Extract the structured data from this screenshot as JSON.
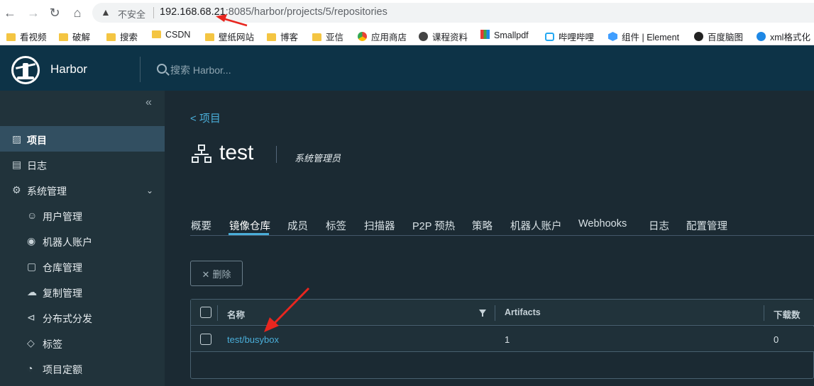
{
  "browser": {
    "insecure_label": "不安全",
    "url_host": "192.168.68.21",
    "url_rest": ":8085/harbor/projects/5/repositories"
  },
  "bookmarks": [
    {
      "label": "看视频",
      "icon": "folder-icon"
    },
    {
      "label": "破解",
      "icon": "folder-icon"
    },
    {
      "label": "搜索",
      "icon": "folder-icon"
    },
    {
      "label": "CSDN",
      "icon": "folder-icon"
    },
    {
      "label": "壁纸网站",
      "icon": "folder-icon"
    },
    {
      "label": "博客",
      "icon": "folder-icon"
    },
    {
      "label": "亚信",
      "icon": "folder-icon"
    },
    {
      "label": "应用商店",
      "icon": "app-store-icon"
    },
    {
      "label": "课程资料",
      "icon": "globe-icon"
    },
    {
      "label": "Smallpdf",
      "icon": "smallpdf-icon"
    },
    {
      "label": "哔哩哔哩",
      "icon": "bilibili-icon"
    },
    {
      "label": "组件 | Element",
      "icon": "element-icon"
    },
    {
      "label": "百度脑图",
      "icon": "owl-icon"
    },
    {
      "label": "xml格式化",
      "icon": "code-icon"
    }
  ],
  "header": {
    "brand": "Harbor",
    "search_placeholder": "搜索 Harbor..."
  },
  "sidebar": {
    "items": [
      {
        "label": "项目",
        "icon": "projects-icon"
      },
      {
        "label": "日志",
        "icon": "logs-icon"
      },
      {
        "label": "系统管理",
        "icon": "admin-icon"
      },
      {
        "label": "用户管理",
        "icon": "users-icon"
      },
      {
        "label": "机器人账户",
        "icon": "robot-icon"
      },
      {
        "label": "仓库管理",
        "icon": "registry-icon"
      },
      {
        "label": "复制管理",
        "icon": "replication-icon"
      },
      {
        "label": "分布式分发",
        "icon": "distribution-icon"
      },
      {
        "label": "标签",
        "icon": "tag-icon"
      },
      {
        "label": "项目定额",
        "icon": "quota-icon"
      }
    ]
  },
  "main": {
    "back_label": "< 项目",
    "project_name": "test",
    "role": "系统管理员",
    "tabs": [
      {
        "label": "概要"
      },
      {
        "label": "镜像仓库"
      },
      {
        "label": "成员"
      },
      {
        "label": "标签"
      },
      {
        "label": "扫描器"
      },
      {
        "label": "P2P 预热"
      },
      {
        "label": "策略"
      },
      {
        "label": "机器人账户"
      },
      {
        "label": "Webhooks"
      },
      {
        "label": "日志"
      },
      {
        "label": "配置管理"
      }
    ],
    "delete_label": "删除",
    "table": {
      "headers": {
        "name": "名称",
        "artifacts": "Artifacts",
        "downloads": "下载数"
      },
      "rows": [
        {
          "name": "test/busybox",
          "artifacts": "1",
          "downloads": "0"
        }
      ]
    }
  },
  "colors": {
    "accent": "#4aaed9",
    "header_bg": "#0d3347",
    "sidebar_bg": "#21333b",
    "main_bg": "#1b2a33",
    "annotation": "#e8261f"
  }
}
